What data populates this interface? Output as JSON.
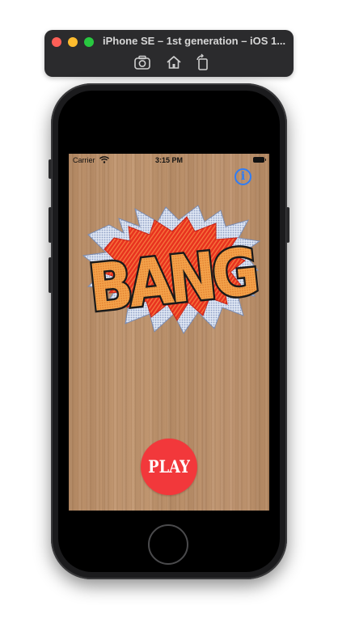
{
  "simulator": {
    "title": "iPhone SE – 1st generation – iOS 1...",
    "toolbar_icons": [
      "camera-icon",
      "home-icon",
      "rotate-icon"
    ]
  },
  "status_bar": {
    "carrier": "Carrier",
    "time": "3:15 PM"
  },
  "app": {
    "info_glyph": "i",
    "logo_text": "BANG",
    "play_label": "PLAY"
  },
  "colors": {
    "info_blue": "#2f7df6",
    "play_red": "#f2383b",
    "logo_orange": "#f3a24a",
    "burst_red": "#e8321f",
    "wood": "#bd926c"
  }
}
